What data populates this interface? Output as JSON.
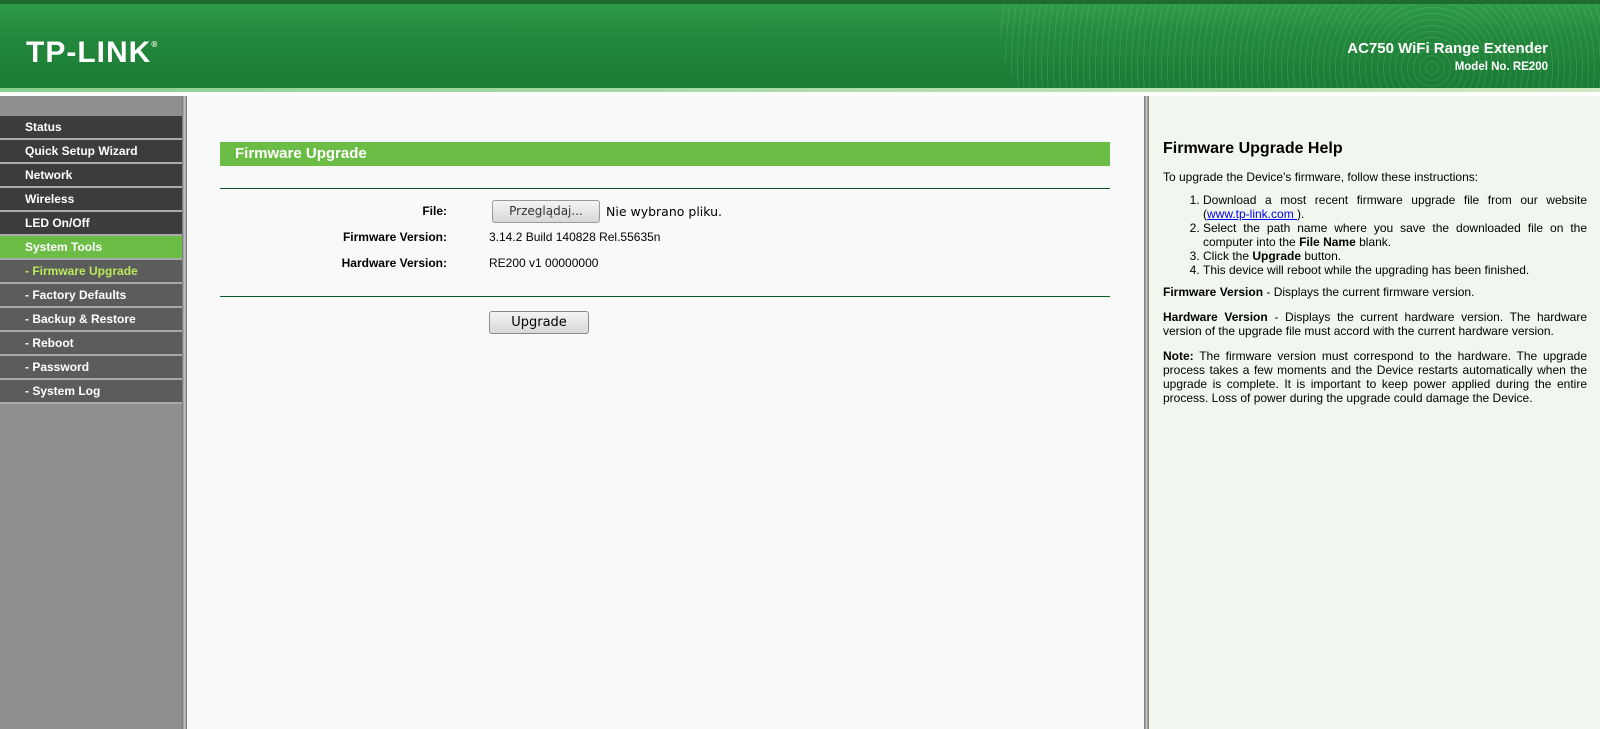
{
  "header": {
    "logo": "TP-LINK",
    "logo_mark": "®",
    "product_name": "AC750 WiFi Range Extender",
    "model_no": "Model No. RE200"
  },
  "sidebar": {
    "items": [
      {
        "label": "Status"
      },
      {
        "label": "Quick Setup Wizard"
      },
      {
        "label": "Network"
      },
      {
        "label": "Wireless"
      },
      {
        "label": "LED On/Off"
      },
      {
        "label": "System Tools"
      },
      {
        "label": "- Firmware Upgrade"
      },
      {
        "label": "- Factory Defaults"
      },
      {
        "label": "- Backup & Restore"
      },
      {
        "label": "- Reboot"
      },
      {
        "label": "- Password"
      },
      {
        "label": "- System Log"
      }
    ]
  },
  "main": {
    "title": "Firmware Upgrade",
    "file_label": "File:",
    "browse_label": "Przeglądaj...",
    "no_file_text": "Nie wybrano pliku.",
    "firmware_label": "Firmware Version:",
    "firmware_value": "3.14.2 Build 140828 Rel.55635n",
    "hardware_label": "Hardware Version:",
    "hardware_value": "RE200 v1 00000000",
    "upgrade_label": "Upgrade"
  },
  "help": {
    "title": "Firmware Upgrade Help",
    "intro": "To upgrade the Device's firmware, follow these instructions:",
    "step1_a": "Download a most recent firmware upgrade file from our website (",
    "step1_link": "www.tp-link.com ",
    "step1_b": ").",
    "step2_a": "Select the path name where you save the downloaded file on the computer into the ",
    "step2_bold": "File Name",
    "step2_b": " blank.",
    "step3_a": "Click the ",
    "step3_bold": "Upgrade",
    "step3_b": " button.",
    "step4": "This device will reboot while the upgrading has been finished.",
    "fw_term": "Firmware Version",
    "fw_desc": " - Displays the current firmware version.",
    "hw_term": "Hardware Version",
    "hw_desc": " - Displays the current hardware version. The hardware version of the upgrade file must accord with the current hardware version.",
    "note_term": "Note:",
    "note_desc": " The firmware version must correspond to the hardware. The upgrade process takes a few moments and the Device restarts automatically when the upgrade is complete. It is important to keep power applied during the entire process. Loss of power during the upgrade could damage the Device."
  }
}
